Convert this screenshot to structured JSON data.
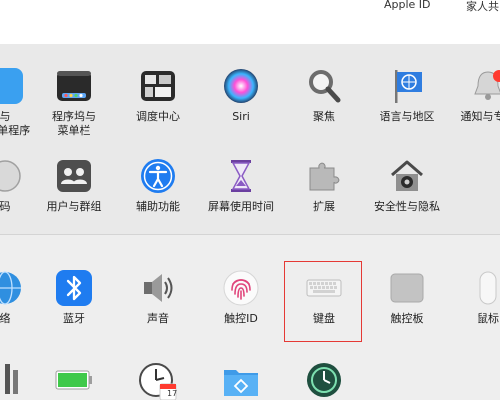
{
  "header": {
    "apple_id": "Apple ID",
    "family": "家人共"
  },
  "row1": [
    {
      "id": "partial-left-1",
      "label1": "与",
      "label2": "P菜单程序",
      "icon": "partial-blue-icon"
    },
    {
      "id": "dock",
      "label1": "程序坞与",
      "label2": "菜单栏",
      "icon": "dock-icon"
    },
    {
      "id": "mission-control",
      "label1": "调度中心",
      "icon": "mission-control-icon"
    },
    {
      "id": "siri",
      "label1": "Siri",
      "icon": "siri-icon"
    },
    {
      "id": "spotlight",
      "label1": "聚焦",
      "icon": "magnifier-icon"
    },
    {
      "id": "language",
      "label1": "语言与地区",
      "icon": "flag-globe-icon"
    },
    {
      "id": "notifications",
      "label1": "通知与专注",
      "icon": "bell-icon"
    }
  ],
  "row2": [
    {
      "id": "partial-left-2",
      "label1": "码",
      "icon": "partial-icon"
    },
    {
      "id": "users",
      "label1": "用户与群组",
      "icon": "users-icon"
    },
    {
      "id": "accessibility",
      "label1": "辅助功能",
      "icon": "accessibility-icon"
    },
    {
      "id": "screen-time",
      "label1": "屏幕使用时间",
      "icon": "hourglass-icon"
    },
    {
      "id": "extensions",
      "label1": "扩展",
      "icon": "puzzle-icon"
    },
    {
      "id": "security",
      "label1": "安全性与隐私",
      "icon": "house-icon"
    }
  ],
  "row3": [
    {
      "id": "partial-left-3",
      "label1": "络",
      "icon": "globe-icon"
    },
    {
      "id": "bluetooth",
      "label1": "蓝牙",
      "icon": "bluetooth-icon"
    },
    {
      "id": "sound",
      "label1": "声音",
      "icon": "speaker-icon"
    },
    {
      "id": "touch-id",
      "label1": "触控ID",
      "icon": "fingerprint-icon"
    },
    {
      "id": "keyboard",
      "label1": "键盘",
      "icon": "keyboard-icon"
    },
    {
      "id": "trackpad",
      "label1": "触控板",
      "icon": "trackpad-icon"
    },
    {
      "id": "mouse",
      "label1": "鼠标",
      "icon": "mouse-icon"
    }
  ],
  "row4": [
    {
      "id": "partial-left-4",
      "icon": "printer-icon"
    },
    {
      "id": "battery",
      "icon": "battery-icon"
    },
    {
      "id": "date-time",
      "icon": "clock-calendar-icon",
      "calendar_day": "17"
    },
    {
      "id": "sharing",
      "icon": "folder-icon"
    },
    {
      "id": "time-machine",
      "icon": "time-machine-icon"
    }
  ],
  "colors": {
    "highlight": "#e53935",
    "accent": "#1f7cf0"
  }
}
